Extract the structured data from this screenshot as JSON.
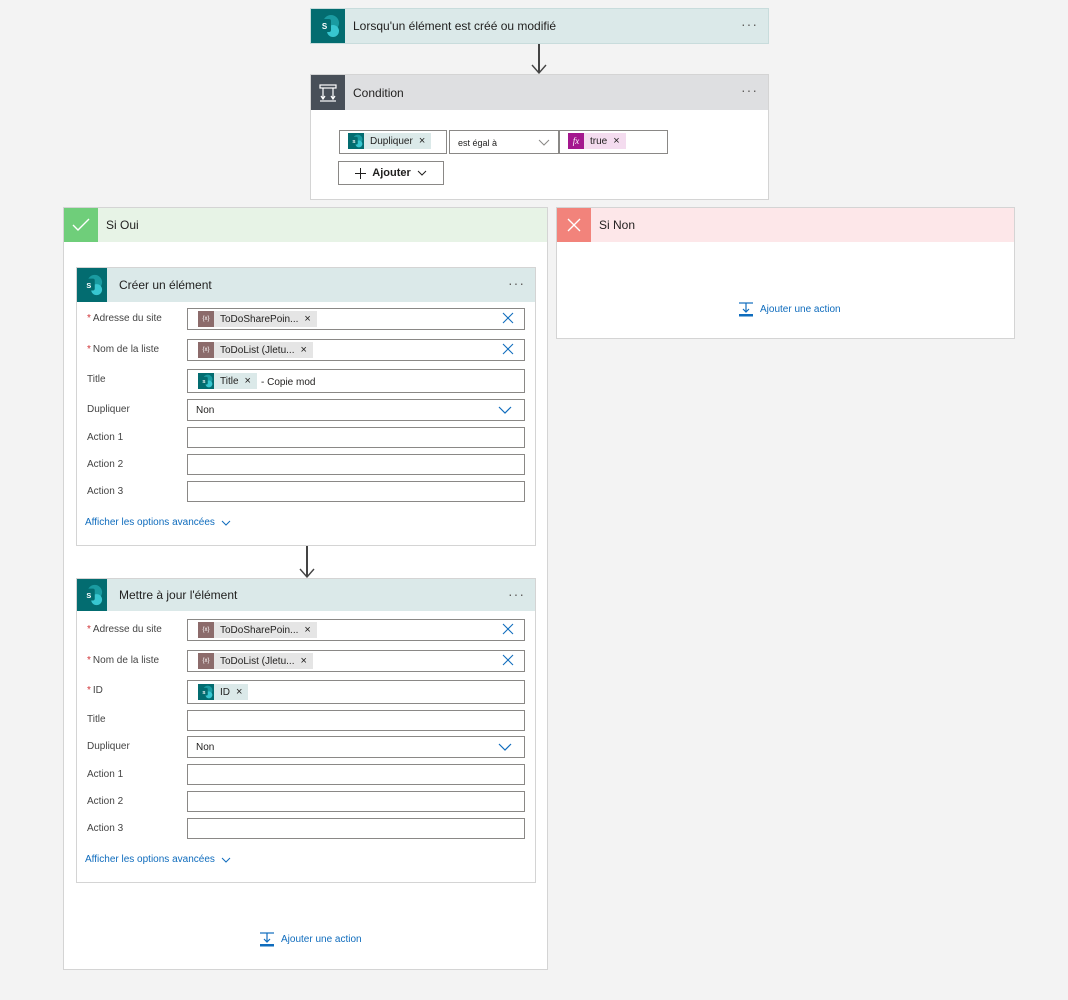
{
  "trigger": {
    "title": "Lorsqu'un élément est créé ou modifié",
    "icon": "sharepoint-icon",
    "menu": "···"
  },
  "condition": {
    "title": "Condition",
    "icon": "condition-icon",
    "menu": "···",
    "left_token": "Dupliquer",
    "operator": "est égal à",
    "right_token": "true",
    "right_token_icon": "fx",
    "add_label": "Ajouter"
  },
  "yes_branch": {
    "title": "Si Oui",
    "add_action": "Ajouter une action"
  },
  "no_branch": {
    "title": "Si Non",
    "add_action": "Ajouter une action"
  },
  "create_item": {
    "title": "Créer un élément",
    "menu": "···",
    "site_label": "Adresse du site",
    "site_token": "ToDoSharePoin...",
    "list_label": "Nom de la liste",
    "list_token": "ToDoList (Jletu...",
    "title_label": "Title",
    "title_token": "Title",
    "title_suffix": "- Copie mod",
    "dup_label": "Dupliquer",
    "dup_value": "Non",
    "action1_label": "Action 1",
    "action2_label": "Action 2",
    "action3_label": "Action 3",
    "advanced": "Afficher les options avancées"
  },
  "update_item": {
    "title": "Mettre à jour l'élément",
    "menu": "···",
    "site_label": "Adresse du site",
    "site_token": "ToDoSharePoin...",
    "list_label": "Nom de la liste",
    "list_token": "ToDoList (Jletu...",
    "id_label": "ID",
    "id_token": "ID",
    "title_label": "Title",
    "dup_label": "Dupliquer",
    "dup_value": "Non",
    "action1_label": "Action 1",
    "action2_label": "Action 2",
    "action3_label": "Action 3",
    "advanced": "Afficher les options avancées"
  },
  "token_var_icon": "{x}",
  "required_mark": "*",
  "token_remove": "×",
  "colors": {
    "sharepoint": "#036c70",
    "variable": "#8c6b6b",
    "expression": "#a4178e",
    "link": "#0f6cbd",
    "yes": "#6fce7a",
    "no": "#f2837b"
  }
}
